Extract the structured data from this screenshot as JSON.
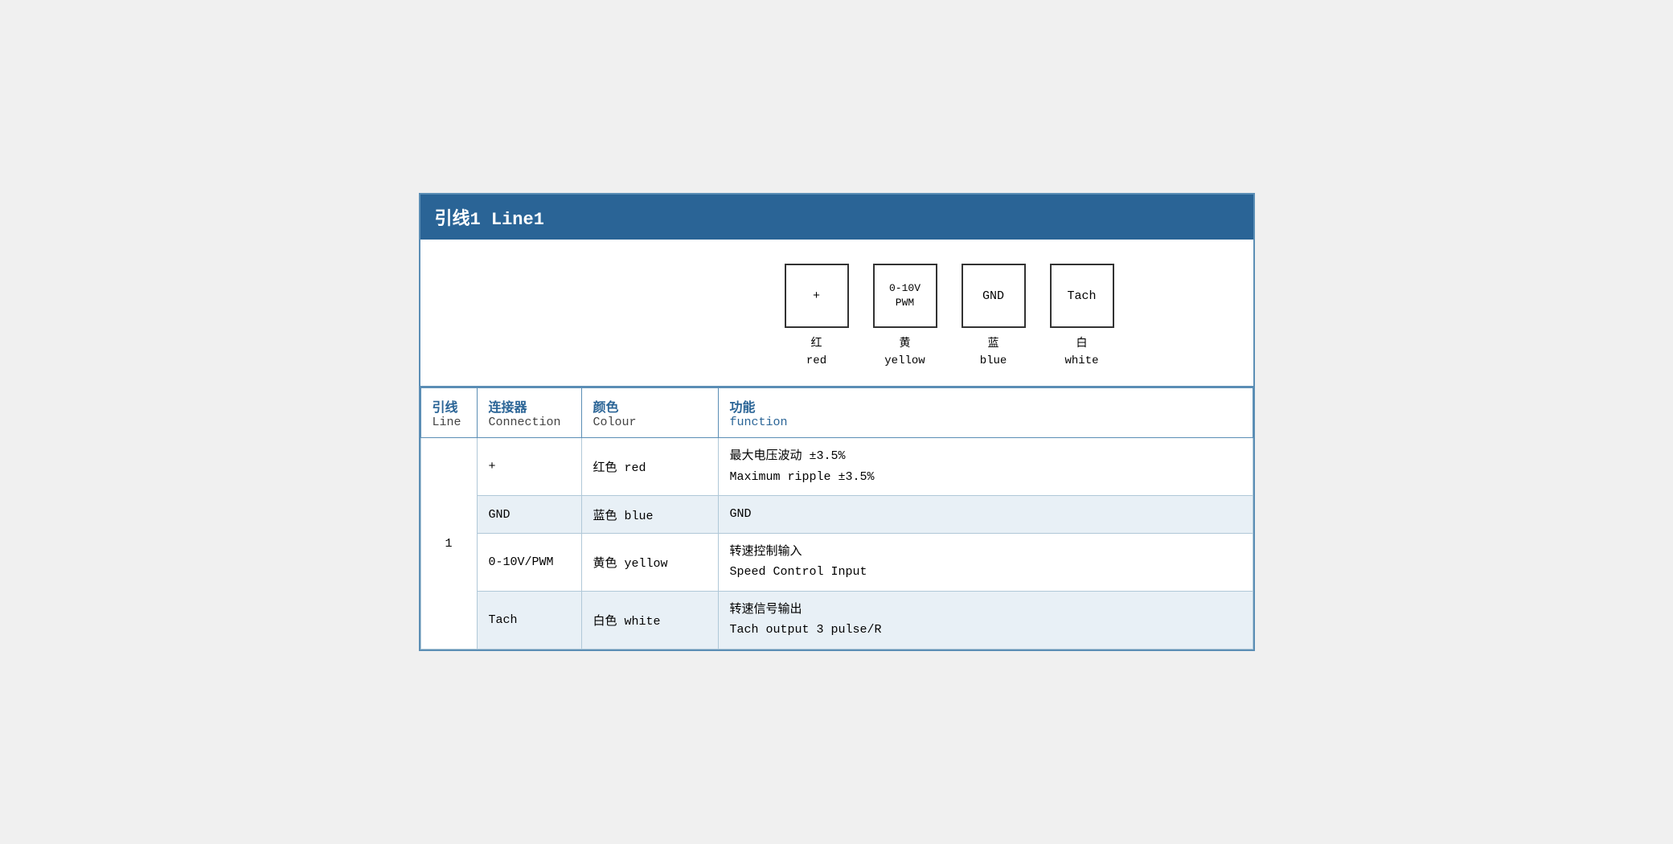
{
  "header": {
    "title": "引线1 Line1"
  },
  "diagram": {
    "terminals": [
      {
        "label": "+",
        "cn": "红",
        "en": "red"
      },
      {
        "label": "0-10V\nPWM",
        "cn": "黄",
        "en": "yellow"
      },
      {
        "label": "GND",
        "cn": "蓝",
        "en": "blue"
      },
      {
        "label": "Tach",
        "cn": "白",
        "en": "white"
      }
    ]
  },
  "table": {
    "headers": {
      "line_cn": "引线",
      "line_en": "Line",
      "connection_cn": "连接器",
      "connection_en": "Connection",
      "colour_cn": "颜色",
      "colour_en": "Colour",
      "function_cn": "功能",
      "function_en": "function"
    },
    "rows": [
      {
        "line": "1",
        "connector": "+",
        "colour": "红色 red",
        "function_cn": "最大电压波动 ±3.5%",
        "function_en": "Maximum ripple ±3.5%",
        "shaded": false
      },
      {
        "line": "",
        "connector": "GND",
        "colour": "蓝色 blue",
        "function_cn": "GND",
        "function_en": "",
        "shaded": true
      },
      {
        "line": "",
        "connector": "0-10V/PWM",
        "colour": "黄色 yellow",
        "function_cn": "转速控制输入",
        "function_en": "Speed Control Input",
        "shaded": false
      },
      {
        "line": "",
        "connector": "Tach",
        "colour": "白色 white",
        "function_cn": "转速信号输出",
        "function_en": "Tach output 3 pulse/R",
        "shaded": true
      }
    ]
  }
}
